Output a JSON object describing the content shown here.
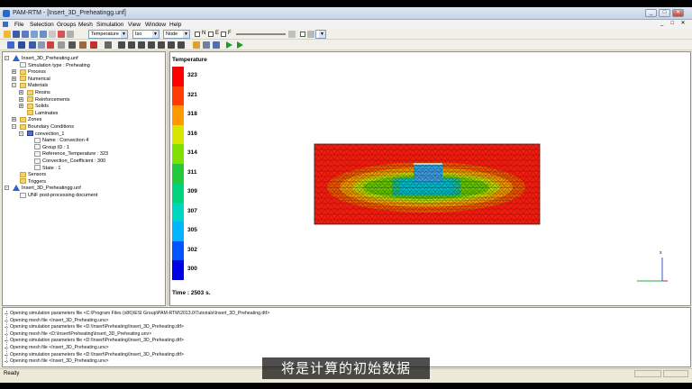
{
  "window": {
    "title": "PAM-RTM - [Insert_3D_Preheatingg.unf]",
    "controls": [
      "_",
      "□",
      "✕"
    ]
  },
  "menu": [
    "File",
    "Selection",
    "Groups",
    "Mesh",
    "Simulation",
    "View",
    "Window",
    "Help"
  ],
  "toolbar": {
    "display_combo": "Temperature",
    "iso_combo": "Iso",
    "location_combo": "Node",
    "checks": [
      "N",
      "E",
      "F"
    ]
  },
  "tree": [
    {
      "label": "Insert_3D_Preheating.unf",
      "icon": "model-icon",
      "level": 0,
      "exp": "-"
    },
    {
      "label": "Simulation type : Preheating",
      "icon": "doc-icon",
      "level": 1,
      "exp": ""
    },
    {
      "label": "Process",
      "icon": "folder-icon",
      "level": 1,
      "exp": "+"
    },
    {
      "label": "Numerical",
      "icon": "folder-icon",
      "level": 1,
      "exp": "+"
    },
    {
      "label": "Materials",
      "icon": "folder-icon",
      "level": 1,
      "exp": "-"
    },
    {
      "label": "Resins",
      "icon": "folder-icon",
      "level": 2,
      "exp": "+"
    },
    {
      "label": "Reinforcements",
      "icon": "folder-icon",
      "level": 2,
      "exp": "+"
    },
    {
      "label": "Solids",
      "icon": "folder-icon",
      "level": 2,
      "exp": "+"
    },
    {
      "label": "Laminates",
      "icon": "folder-icon",
      "level": 2,
      "exp": ""
    },
    {
      "label": "Zones",
      "icon": "folder-icon",
      "level": 1,
      "exp": "+"
    },
    {
      "label": "Boundary Conditions",
      "icon": "folder-icon",
      "level": 1,
      "exp": "-"
    },
    {
      "label": "convection_1",
      "icon": "grid-icon",
      "level": 2,
      "exp": "-"
    },
    {
      "label": "Name : Convection 4",
      "icon": "doc-icon",
      "level": 3,
      "exp": ""
    },
    {
      "label": "Group ID : 1",
      "icon": "doc-icon",
      "level": 3,
      "exp": ""
    },
    {
      "label": "Reference_Temperature : 323",
      "icon": "doc-icon",
      "level": 3,
      "exp": ""
    },
    {
      "label": "Convection_Coefficient : 300",
      "icon": "doc-icon",
      "level": 3,
      "exp": ""
    },
    {
      "label": "State : 1",
      "icon": "doc-icon",
      "level": 3,
      "exp": ""
    },
    {
      "label": "Sensors",
      "icon": "folder-icon",
      "level": 1,
      "exp": ""
    },
    {
      "label": "Triggers",
      "icon": "folder-icon",
      "level": 1,
      "exp": ""
    },
    {
      "label": "Insert_3D_Preheatingg.unf",
      "icon": "model-icon",
      "level": 0,
      "exp": "-"
    },
    {
      "label": "UNF post-processing document",
      "icon": "doc-icon",
      "level": 1,
      "exp": ""
    }
  ],
  "legend": {
    "title": "Temperature",
    "labels": [
      "323",
      "321",
      "318",
      "316",
      "314",
      "311",
      "309",
      "307",
      "305",
      "302",
      "300"
    ],
    "colors": [
      "#ff0000",
      "#ff3c00",
      "#ff9900",
      "#d7e600",
      "#80e000",
      "#24c93c",
      "#00d27e",
      "#00d7c0",
      "#00b5ff",
      "#0055ff",
      "#0000e8"
    ]
  },
  "time_label": "Time : 2503 s.",
  "axis_label": "x",
  "console": [
    "Opening simulation parameters file <C:\\Program Files (x86)\\ESI Group\\PAM-RTM\\2013.0\\Tutorials\\Insert_3D_Preheating.dtf>",
    "Opening mesh file <Insert_3D_Preheating.unv>",
    "Opening simulation parameters file <D:\\Insert\\Preheating\\Insert_3D_Preheating.dtf>",
    "Opening mesh file <D:\\Insert\\Preheating\\Insert_3D_Preheating.unv>",
    "Opening simulation parameters file <D:\\Insert\\Preheating\\Insert_3D_Preheating.dtf>",
    "Opening mesh file <Insert_3D_Preheating.unv>",
    "Opening simulation parameters file <D:\\Insert\\Preheating\\Insert_3D_Preheating.dtf>",
    "Opening mesh file <Insert_3D_Preheating.unv>"
  ],
  "status": "Ready",
  "subtitle": "将是计算的初始数据"
}
